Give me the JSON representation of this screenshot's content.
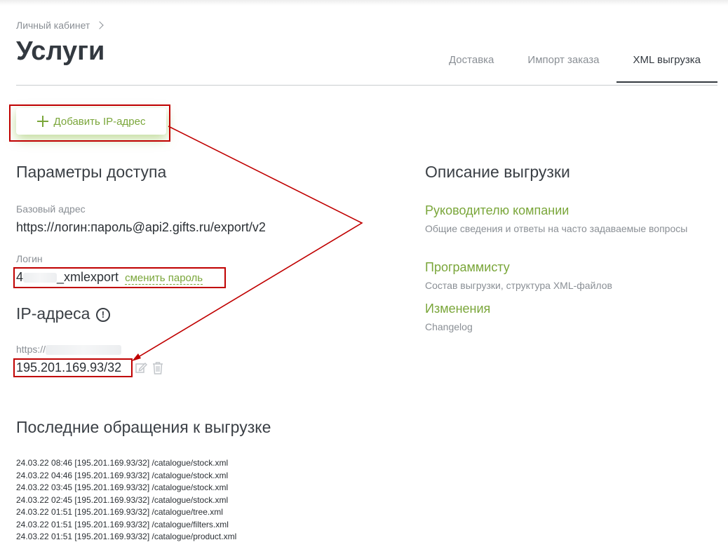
{
  "breadcrumb": {
    "label": "Личный кабинет"
  },
  "page": {
    "title": "Услуги"
  },
  "tabs": [
    {
      "label": "Доставка"
    },
    {
      "label": "Импорт заказа"
    },
    {
      "label": "XML выгрузка"
    }
  ],
  "add_ip_button": {
    "label": "Добавить IP-адрес"
  },
  "access": {
    "heading": "Параметры доступа",
    "base_address_label": "Базовый адрес",
    "base_address_value": "https://логин:пароль@api2.gifts.ru/export/v2",
    "login_label": "Логин",
    "login_prefix": "4",
    "login_suffix": "_xmlexport",
    "change_password": "сменить пароль"
  },
  "ip": {
    "heading": "IP-адреса",
    "info_glyph": "!",
    "url_prefix": "https://",
    "address": "195.201.169.93/32"
  },
  "description": {
    "heading": "Описание выгрузки",
    "items": [
      {
        "title": "Руководителю компании",
        "text": "Общие сведения и ответы на часто задаваемые вопросы"
      },
      {
        "title": "Программисту",
        "text": "Состав выгрузки, структура XML-файлов"
      },
      {
        "title": "Изменения",
        "text": "Changelog"
      }
    ]
  },
  "log": {
    "heading": "Последние обращения к выгрузке",
    "entries": [
      "24.03.22 08:46 [195.201.169.93/32] /catalogue/stock.xml",
      "24.03.22 04:46 [195.201.169.93/32] /catalogue/stock.xml",
      "24.03.22 03:45 [195.201.169.93/32] /catalogue/stock.xml",
      "24.03.22 02:45 [195.201.169.93/32] /catalogue/stock.xml",
      "24.03.22 01:51 [195.201.169.93/32] /catalogue/tree.xml",
      "24.03.22 01:51 [195.201.169.93/32] /catalogue/filters.xml",
      "24.03.22 01:51 [195.201.169.93/32] /catalogue/product.xml"
    ]
  },
  "colors": {
    "accent": "#7aa63a",
    "annotation": "#c00000",
    "text": "#3a3f45",
    "muted": "#8a8f95"
  }
}
